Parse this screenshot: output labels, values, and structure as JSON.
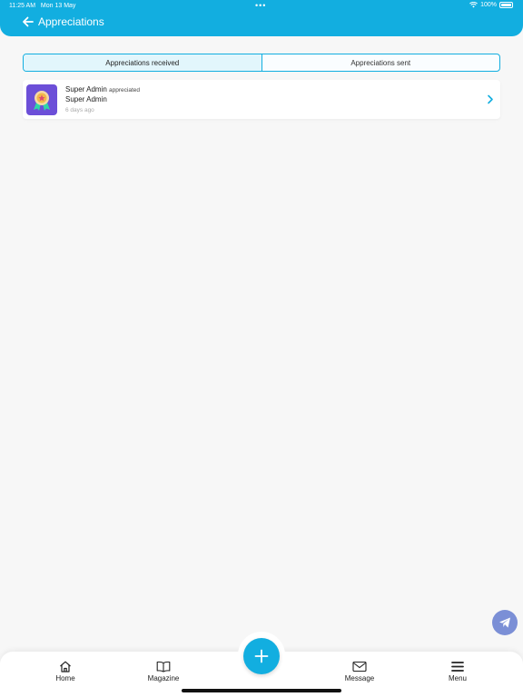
{
  "status_bar": {
    "time": "11:25 AM",
    "date": "Mon 13 May",
    "battery": "100%"
  },
  "header": {
    "title": "Appreciations"
  },
  "tabs": [
    {
      "label": "Appreciations received",
      "active": true
    },
    {
      "label": "Appreciations sent",
      "active": false
    }
  ],
  "appreciations": [
    {
      "sender": "Super Admin",
      "verb": "appreciated",
      "recipient": "Super Admin",
      "time_ago": "6 days ago",
      "icon": "medal-icon"
    }
  ],
  "bottom_nav": {
    "items": [
      {
        "label": "Home",
        "icon": "home-icon"
      },
      {
        "label": "Magazine",
        "icon": "book-icon"
      },
      {
        "label": "Message",
        "icon": "mail-icon"
      },
      {
        "label": "Menu",
        "icon": "menu-icon"
      }
    ]
  },
  "colors": {
    "accent": "#12aee0",
    "medal_bg": "#6c4fd8",
    "send_button": "#7b8fd6"
  }
}
